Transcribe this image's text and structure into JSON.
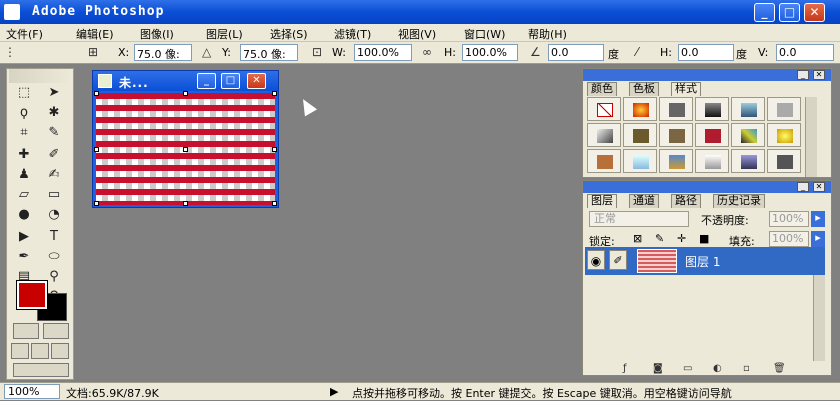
{
  "app": {
    "title": "Adobe Photoshop"
  },
  "menu": [
    "文件(F)",
    "编辑(E)",
    "图像(I)",
    "图层(L)",
    "选择(S)",
    "滤镜(T)",
    "视图(V)",
    "窗口(W)",
    "帮助(H)"
  ],
  "options": {
    "x_label": "X:",
    "x_value": "75.0 像:",
    "y_label": "Y:",
    "y_value": "75.0 像:",
    "w_label": "W:",
    "w_value": "100.0%",
    "h_label": "H:",
    "h_value": "100.0%",
    "rot_value": "0.0",
    "rot_unit": "度",
    "skew_h_label": "H:",
    "skew_h_value": "0.0",
    "skew_unit": "度",
    "skew_v_label": "V:",
    "skew_v_value": "0.0"
  },
  "document": {
    "title": "未..."
  },
  "styles_panel": {
    "tabs": [
      "颜色",
      "色板",
      "样式"
    ]
  },
  "layers_panel": {
    "tabs": [
      "图层",
      "通道",
      "路径",
      "历史记录"
    ],
    "blend_mode": "正常",
    "opacity_label": "不透明度:",
    "opacity_value": "100%",
    "lock_label": "锁定:",
    "fill_label": "填充:",
    "fill_value": "100%",
    "layer_name": "图层 1"
  },
  "status": {
    "zoom": "100%",
    "doc_info": "文档:65.9K/87.9K",
    "hint": "点按并拖移可移动。按 Enter 键提交。按 Escape 键取消。用空格键访问导航"
  },
  "colors": {
    "foreground": "#c80000",
    "background": "#000000",
    "accent": "#0a4fd6"
  }
}
